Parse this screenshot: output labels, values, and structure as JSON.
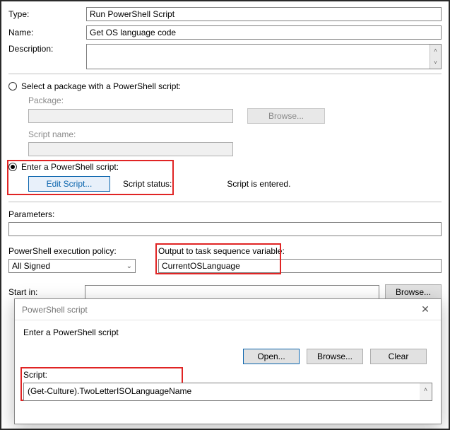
{
  "header": {
    "type_label": "Type:",
    "type_value": "Run PowerShell Script",
    "name_label": "Name:",
    "name_value": "Get OS language code",
    "description_label": "Description:",
    "description_value": ""
  },
  "package_section": {
    "radio_label": "Select a package with a PowerShell script:",
    "package_label": "Package:",
    "package_value": "",
    "browse_label": "Browse...",
    "scriptname_label": "Script name:",
    "scriptname_value": ""
  },
  "enter_section": {
    "radio_label": "Enter a PowerShell script:",
    "edit_btn": "Edit Script...",
    "status_label": "Script status:",
    "status_value": "Script is entered."
  },
  "params": {
    "label": "Parameters:",
    "value": ""
  },
  "policy": {
    "label": "PowerShell execution policy:",
    "value": "All Signed"
  },
  "outputvar": {
    "label": "Output to task sequence variable:",
    "value": "CurrentOSLanguage"
  },
  "startin": {
    "label": "Start in:",
    "value": "",
    "browse_label": "Browse..."
  },
  "dialog": {
    "title": "PowerShell script",
    "prompt": "Enter a PowerShell script",
    "open_btn": "Open...",
    "browse_btn": "Browse...",
    "clear_btn": "Clear",
    "script_label": "Script:",
    "script_value": "(Get-Culture).TwoLetterISOLanguageName"
  }
}
